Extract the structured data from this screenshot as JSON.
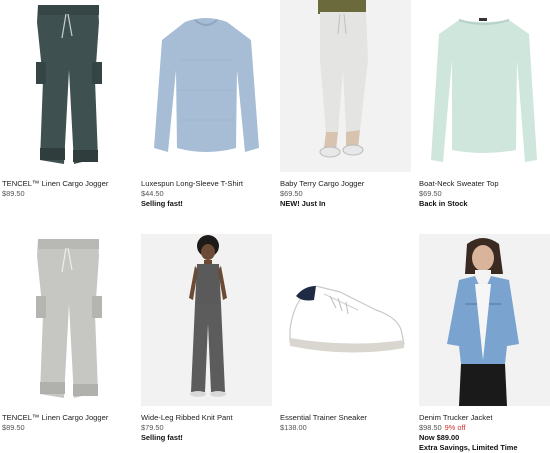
{
  "products": [
    {
      "name": "TENCEL™ Linen Cargo Jogger",
      "price": "$89.50",
      "badge": "",
      "image": "jogger-dark-green",
      "image_bg": "#ffffff"
    },
    {
      "name": "Luxespun Long-Sleeve T-Shirt",
      "price": "$44.50",
      "badge": "Selling fast!",
      "image": "tee-heather-blue",
      "image_bg": "#ffffff"
    },
    {
      "name": "Baby Terry Cargo Jogger",
      "price": "$69.50",
      "badge": "NEW! Just In",
      "image": "jogger-light-grey-model",
      "image_bg": "#f2f2f2"
    },
    {
      "name": "Boat-Neck Sweater Top",
      "price": "$69.50",
      "badge": "Back in Stock",
      "image": "sweater-mint",
      "image_bg": "#ffffff"
    },
    {
      "name": "TENCEL™ Linen Cargo Jogger",
      "price": "$89.50",
      "badge": "",
      "image": "jogger-light-grey",
      "image_bg": "#ffffff"
    },
    {
      "name": "Wide-Leg Ribbed Knit Pant",
      "price": "$79.50",
      "badge": "Selling fast!",
      "image": "knit-set-model",
      "image_bg": "#f2f2f2"
    },
    {
      "name": "Essential Trainer Sneaker",
      "price": "$138.00",
      "badge": "",
      "image": "sneaker-white",
      "image_bg": "#ffffff"
    },
    {
      "name": "Denim Trucker Jacket",
      "price": "$98.50",
      "discount": "9% off",
      "sale_price": "Now $89.00",
      "badge": "Extra Savings, Limited Time",
      "image": "denim-jacket-model",
      "image_bg": "#f2f2f2"
    }
  ],
  "colors": {
    "sale_red": "#d0312d",
    "text_dark": "#111111",
    "text_grey": "#555555"
  }
}
